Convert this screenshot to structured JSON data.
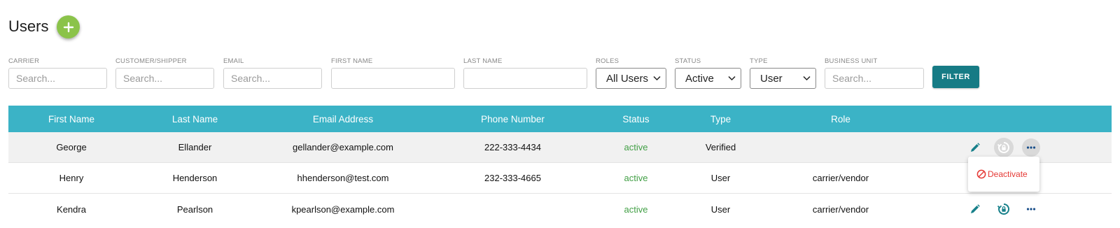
{
  "page": {
    "title": "Users"
  },
  "filters": {
    "carrier": {
      "label": "CARRIER",
      "placeholder": "Search..."
    },
    "customer_shipper": {
      "label": "CUSTOMER/SHIPPER",
      "placeholder": "Search..."
    },
    "email": {
      "label": "EMAIL",
      "placeholder": "Search..."
    },
    "first_name": {
      "label": "FIRST NAME",
      "value": ""
    },
    "last_name": {
      "label": "LAST NAME",
      "value": ""
    },
    "roles": {
      "label": "ROLES",
      "value": "All Users"
    },
    "status": {
      "label": "STATUS",
      "value": "Active"
    },
    "type": {
      "label": "TYPE",
      "value": "User"
    },
    "business_unit": {
      "label": "BUSINESS UNIT",
      "placeholder": "Search..."
    },
    "filter_button": "FILTER"
  },
  "table": {
    "headers": [
      "First Name",
      "Last Name",
      "Email Address",
      "Phone Number",
      "Status",
      "Type",
      "Role"
    ],
    "rows": [
      {
        "first": "George",
        "last": "Ellander",
        "email": "gellander@example.com",
        "phone": "222-333-4434",
        "status": "active",
        "type": "Verified",
        "role": ""
      },
      {
        "first": "Henry",
        "last": "Henderson",
        "email": "hhenderson@test.com",
        "phone": "232-333-4665",
        "status": "active",
        "type": "User",
        "role": "carrier/vendor"
      },
      {
        "first": "Kendra",
        "last": "Pearlson",
        "email": "kpearlson@example.com",
        "phone": "",
        "status": "active",
        "type": "User",
        "role": "carrier/vendor"
      }
    ]
  },
  "menu": {
    "deactivate": "Deactivate"
  },
  "colors": {
    "header_bg": "#3bb3c6",
    "filter_button": "#167b85",
    "add_button": "#8bc34a",
    "active_status": "#43a047",
    "deactivate": "#e53935",
    "icon": "#17808a"
  },
  "icons": {
    "add": "plus-icon",
    "edit": "pencil-icon",
    "reset": "lock-reset-icon",
    "more": "ellipsis-icon",
    "deactivate": "ban-icon"
  }
}
